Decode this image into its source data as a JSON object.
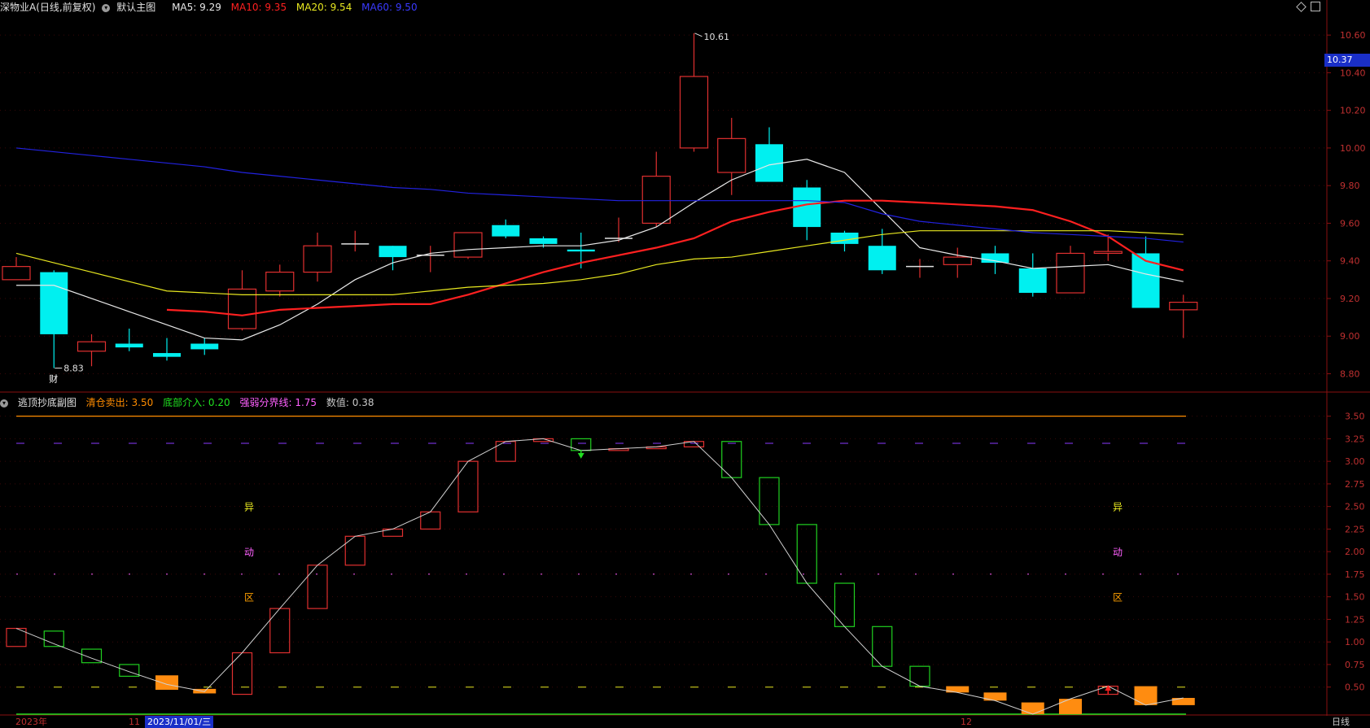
{
  "main_header": {
    "title": "深物业A(日线,前复权)",
    "template": "默认主图",
    "ma5": "MA5: 9.29",
    "ma10": "MA10: 9.35",
    "ma20": "MA20: 9.54",
    "ma60": "MA60: 9.50"
  },
  "sub_header": {
    "title": "逃顶抄底副图",
    "sell": "清仓卖出: 3.50",
    "buy": "底部介入: 0.20",
    "divide": "强弱分界线: 1.75",
    "value": "数值: 0.38"
  },
  "colors": {
    "up": "#e03030",
    "down": "#00f0f0",
    "ma5": "#e8e8e8",
    "ma10": "#ff2020",
    "ma20": "#e8e820",
    "ma60": "#2222e0",
    "sub_line": "#d0d0d0"
  },
  "current_price": "10.37",
  "high_label": "10.61",
  "low_label": "8.83",
  "fin_marker": "财",
  "zone_labels": [
    "异",
    "动",
    "区"
  ],
  "bottom_axis": {
    "year": "2023年",
    "month11": "11",
    "date": "2023/11/01/三",
    "month12": "12",
    "period": "日线"
  },
  "chart_data": [
    {
      "type": "candlestick",
      "title": "深物业A(日线,前复权)",
      "ylim": [
        8.72,
        10.7
      ],
      "y_ticks": [
        "10.60",
        "10.40",
        "10.20",
        "10.00",
        "9.80",
        "9.60",
        "9.40",
        "9.20",
        "9.00",
        "8.80"
      ],
      "candles": [
        {
          "o": 9.3,
          "c": 9.37,
          "h": 9.42,
          "l": 9.3
        },
        {
          "o": 9.34,
          "c": 9.01,
          "h": 9.35,
          "l": 8.83
        },
        {
          "o": 8.92,
          "c": 8.97,
          "h": 9.01,
          "l": 8.84
        },
        {
          "o": 8.96,
          "c": 8.94,
          "h": 9.04,
          "l": 8.92
        },
        {
          "o": 8.91,
          "c": 8.89,
          "h": 8.99,
          "l": 8.87
        },
        {
          "o": 8.96,
          "c": 8.93,
          "h": 8.99,
          "l": 8.9
        },
        {
          "o": 9.04,
          "c": 9.25,
          "h": 9.35,
          "l": 9.03
        },
        {
          "o": 9.24,
          "c": 9.34,
          "h": 9.38,
          "l": 9.21
        },
        {
          "o": 9.34,
          "c": 9.48,
          "h": 9.55,
          "l": 9.29
        },
        {
          "o": 9.49,
          "c": 9.49,
          "h": 9.56,
          "l": 9.45
        },
        {
          "o": 9.48,
          "c": 9.42,
          "h": 9.48,
          "l": 9.35
        },
        {
          "o": 9.43,
          "c": 9.43,
          "h": 9.48,
          "l": 9.34
        },
        {
          "o": 9.42,
          "c": 9.55,
          "h": 9.55,
          "l": 9.41
        },
        {
          "o": 9.59,
          "c": 9.53,
          "h": 9.62,
          "l": 9.52
        },
        {
          "o": 9.52,
          "c": 9.49,
          "h": 9.53,
          "l": 9.47
        },
        {
          "o": 9.46,
          "c": 9.45,
          "h": 9.55,
          "l": 9.36
        },
        {
          "o": 9.52,
          "c": 9.52,
          "h": 9.63,
          "l": 9.5
        },
        {
          "o": 9.6,
          "c": 9.85,
          "h": 9.98,
          "l": 9.58
        },
        {
          "o": 10.0,
          "c": 10.38,
          "h": 10.61,
          "l": 9.98
        },
        {
          "o": 9.87,
          "c": 10.05,
          "h": 10.16,
          "l": 9.75
        },
        {
          "o": 10.02,
          "c": 9.82,
          "h": 10.11,
          "l": 9.82
        },
        {
          "o": 9.79,
          "c": 9.58,
          "h": 9.83,
          "l": 9.51
        },
        {
          "o": 9.55,
          "c": 9.49,
          "h": 9.56,
          "l": 9.45
        },
        {
          "o": 9.48,
          "c": 9.35,
          "h": 9.57,
          "l": 9.33
        },
        {
          "o": 9.37,
          "c": 9.37,
          "h": 9.41,
          "l": 9.31
        },
        {
          "o": 9.38,
          "c": 9.42,
          "h": 9.47,
          "l": 9.31
        },
        {
          "o": 9.44,
          "c": 9.39,
          "h": 9.48,
          "l": 9.33
        },
        {
          "o": 9.36,
          "c": 9.23,
          "h": 9.44,
          "l": 9.21
        },
        {
          "o": 9.23,
          "c": 9.44,
          "h": 9.48,
          "l": 9.23
        },
        {
          "o": 9.44,
          "c": 9.45,
          "h": 9.54,
          "l": 9.4
        },
        {
          "o": 9.44,
          "c": 9.15,
          "h": 9.53,
          "l": 9.15
        },
        {
          "o": 9.14,
          "c": 9.18,
          "h": 9.22,
          "l": 8.99
        }
      ],
      "series": [
        {
          "name": "MA5",
          "values": [
            9.27,
            9.27,
            9.2,
            9.13,
            9.06,
            8.99,
            8.98,
            9.06,
            9.17,
            9.3,
            9.39,
            9.44,
            9.46,
            9.47,
            9.48,
            9.48,
            9.51,
            9.58,
            9.71,
            9.83,
            9.91,
            9.94,
            9.87,
            9.67,
            9.47,
            9.43,
            9.4,
            9.36,
            9.37,
            9.38,
            9.33,
            9.29
          ]
        },
        {
          "name": "MA10",
          "values": [
            null,
            null,
            null,
            null,
            9.14,
            9.13,
            9.11,
            9.14,
            9.15,
            9.16,
            9.17,
            9.17,
            9.22,
            9.28,
            9.34,
            9.39,
            9.43,
            9.47,
            9.52,
            9.61,
            9.66,
            9.7,
            9.72,
            9.72,
            9.71,
            9.7,
            9.69,
            9.67,
            9.61,
            9.53,
            9.4,
            9.35
          ]
        },
        {
          "name": "MA20",
          "values": [
            9.44,
            9.39,
            9.34,
            9.29,
            9.24,
            9.23,
            9.22,
            9.22,
            9.22,
            9.22,
            9.22,
            9.24,
            9.26,
            9.27,
            9.28,
            9.3,
            9.33,
            9.38,
            9.41,
            9.42,
            9.45,
            9.48,
            9.51,
            9.54,
            9.56,
            9.56,
            9.56,
            9.56,
            9.56,
            9.56,
            9.55,
            9.54
          ]
        },
        {
          "name": "MA60",
          "values": [
            10.0,
            9.98,
            9.96,
            9.94,
            9.92,
            9.9,
            9.87,
            9.85,
            9.83,
            9.81,
            9.79,
            9.78,
            9.76,
            9.75,
            9.74,
            9.73,
            9.72,
            9.72,
            9.72,
            9.72,
            9.72,
            9.72,
            9.71,
            9.65,
            9.61,
            9.59,
            9.57,
            9.55,
            9.54,
            9.53,
            9.52,
            9.5
          ]
        }
      ]
    },
    {
      "type": "bar",
      "title": "逃顶抄底副图",
      "ylim": [
        0.2,
        3.65
      ],
      "y_ticks": [
        "3.50",
        "3.25",
        "3.00",
        "2.75",
        "2.50",
        "2.25",
        "2.00",
        "1.75",
        "1.50",
        "1.25",
        "1.00",
        "0.75",
        "0.50"
      ],
      "levels": {
        "sell": 3.5,
        "top_dashed": 3.2,
        "divide": 1.75,
        "bottom_dashed": 0.5,
        "buy": 0.2
      },
      "bars": [
        {
          "o": 0.95,
          "c": 1.15,
          "k": "up"
        },
        {
          "o": 1.12,
          "c": 0.95,
          "k": "down"
        },
        {
          "o": 0.92,
          "c": 0.77,
          "k": "down"
        },
        {
          "o": 0.75,
          "c": 0.62,
          "k": "down"
        },
        {
          "o": 0.63,
          "c": 0.47,
          "k": "weak"
        },
        {
          "o": 0.48,
          "c": 0.43,
          "k": "weak"
        },
        {
          "o": 0.42,
          "c": 0.88,
          "k": "up"
        },
        {
          "o": 0.88,
          "c": 1.37,
          "k": "up"
        },
        {
          "o": 1.37,
          "c": 1.85,
          "k": "up"
        },
        {
          "o": 1.85,
          "c": 2.17,
          "k": "up"
        },
        {
          "o": 2.17,
          "c": 2.25,
          "k": "up"
        },
        {
          "o": 2.25,
          "c": 2.44,
          "k": "up"
        },
        {
          "o": 2.44,
          "c": 3.0,
          "k": "up"
        },
        {
          "o": 3.0,
          "c": 3.22,
          "k": "up"
        },
        {
          "o": 3.22,
          "c": 3.25,
          "k": "up"
        },
        {
          "o": 3.25,
          "c": 3.12,
          "k": "down"
        },
        {
          "o": 3.12,
          "c": 3.14,
          "k": "up"
        },
        {
          "o": 3.14,
          "c": 3.16,
          "k": "up"
        },
        {
          "o": 3.16,
          "c": 3.22,
          "k": "up"
        },
        {
          "o": 3.22,
          "c": 2.82,
          "k": "down"
        },
        {
          "o": 2.82,
          "c": 2.3,
          "k": "down"
        },
        {
          "o": 2.3,
          "c": 1.65,
          "k": "down"
        },
        {
          "o": 1.65,
          "c": 1.17,
          "k": "down"
        },
        {
          "o": 1.17,
          "c": 0.73,
          "k": "down"
        },
        {
          "o": 0.73,
          "c": 0.51,
          "k": "down"
        },
        {
          "o": 0.51,
          "c": 0.44,
          "k": "weak"
        },
        {
          "o": 0.44,
          "c": 0.35,
          "k": "weak"
        },
        {
          "o": 0.33,
          "c": 0.2,
          "k": "weak"
        },
        {
          "o": 0.2,
          "c": 0.37,
          "k": "weak"
        },
        {
          "o": 0.42,
          "c": 0.51,
          "k": "up"
        },
        {
          "o": 0.51,
          "c": 0.3,
          "k": "weak"
        },
        {
          "o": 0.3,
          "c": 0.38,
          "k": "weak"
        }
      ],
      "line": [
        1.15,
        0.98,
        0.82,
        0.67,
        0.53,
        0.45,
        0.88,
        1.37,
        1.85,
        2.17,
        2.25,
        2.44,
        3.0,
        3.22,
        3.25,
        3.12,
        3.14,
        3.16,
        3.22,
        2.82,
        2.3,
        1.65,
        1.17,
        0.73,
        0.51,
        0.44,
        0.35,
        0.2,
        0.37,
        0.51,
        0.3,
        0.38
      ]
    }
  ]
}
